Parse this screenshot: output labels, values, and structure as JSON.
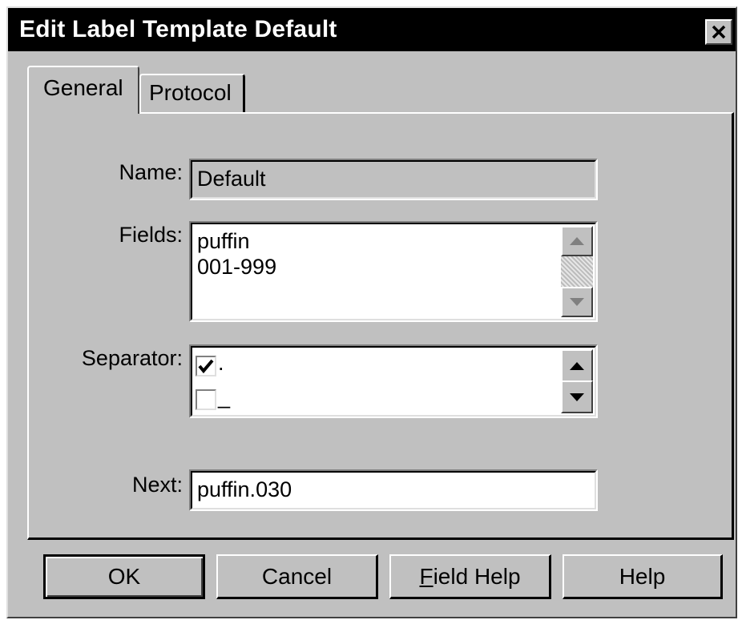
{
  "window": {
    "title": "Edit Label Template Default"
  },
  "tabs": [
    {
      "label": "General",
      "active": true
    },
    {
      "label": "Protocol",
      "active": false
    }
  ],
  "form": {
    "name": {
      "label": "Name:",
      "value": "Default"
    },
    "fields": {
      "label": "Fields:",
      "items": [
        "puffin",
        "001-999"
      ]
    },
    "separator": {
      "label": "Separator:",
      "options": [
        {
          "symbol": ".",
          "checked": true
        },
        {
          "symbol": "_",
          "checked": false
        }
      ]
    },
    "next": {
      "label": "Next:",
      "value": "puffin.030"
    }
  },
  "buttons": {
    "ok": "OK",
    "cancel": "Cancel",
    "field_help": "Field Help",
    "help": "Help"
  },
  "icons": {
    "close": "close-icon",
    "scroll_up": "arrow-up-icon",
    "scroll_down": "arrow-down-icon",
    "check": "check-icon"
  },
  "colors": {
    "dialog_bg": "#c0c0c0",
    "titlebar_bg": "#000000",
    "titlebar_text": "#ffffff"
  }
}
